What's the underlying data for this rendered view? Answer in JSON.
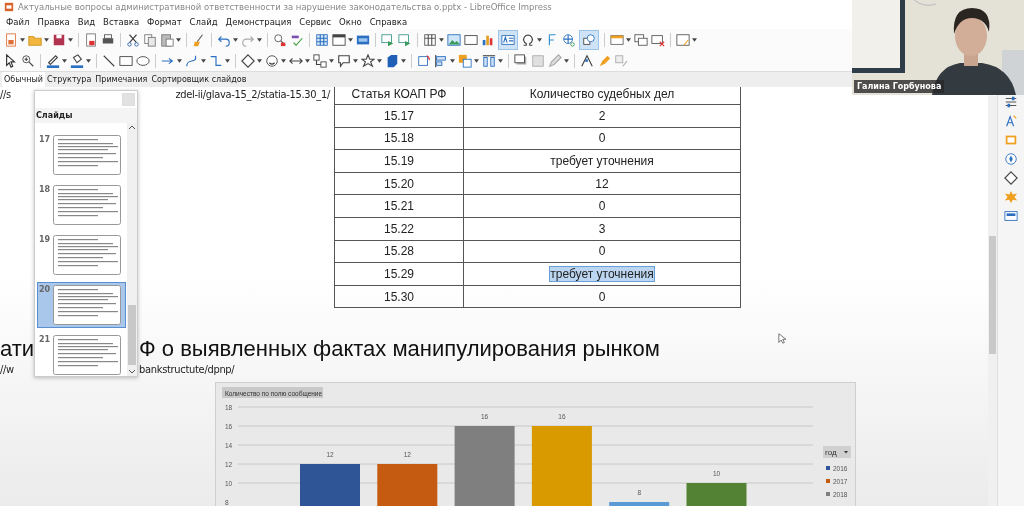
{
  "window": {
    "title": "Актуальные вопросы административной ответственности за нарушение законодательства о.pptx - LibreOffice Impress"
  },
  "menu": [
    "Файл",
    "Правка",
    "Вид",
    "Вставка",
    "Формат",
    "Слайд",
    "Демонстрация",
    "Сервис",
    "Окно",
    "Справка"
  ],
  "toolbar": {
    "insert_text_box": {
      "on": true
    },
    "show_draw_functions": {
      "on": true
    }
  },
  "view_tabs": [
    {
      "label": "Обычный",
      "selected": true
    },
    {
      "label": "Структура",
      "selected": false
    },
    {
      "label": "Примечания",
      "selected": false
    },
    {
      "label": "Сортировщик слайдов",
      "selected": false
    }
  ],
  "slides_panel": {
    "title": "Слайды",
    "slides": [
      {
        "number": "17",
        "selected": false
      },
      {
        "number": "18",
        "selected": false
      },
      {
        "number": "19",
        "selected": false
      },
      {
        "number": "20",
        "selected": true
      },
      {
        "number": "21",
        "selected": false
      }
    ]
  },
  "slide": {
    "link_1": [
      "//s",
      "zdel-ii/glava-15_2/statia-15.30_1/"
    ],
    "table": {
      "columns": [
        "Статья КОАП РФ",
        "Количество судебных дел"
      ],
      "rows": [
        {
          "article": "15.17",
          "count": "2",
          "text_selected": false
        },
        {
          "article": "15.18",
          "count": "0",
          "text_selected": false
        },
        {
          "article": "15.19",
          "count": "требует уточнения",
          "text_selected": false
        },
        {
          "article": "15.20",
          "count": "12",
          "text_selected": false
        },
        {
          "article": "15.21",
          "count": "0",
          "text_selected": false
        },
        {
          "article": "15.22",
          "count": "3",
          "text_selected": false
        },
        {
          "article": "15.28",
          "count": "0",
          "text_selected": false
        },
        {
          "article": "15.29",
          "count": "требует уточнения",
          "text_selected": true
        },
        {
          "article": "15.30",
          "count": "0",
          "text_selected": false
        }
      ]
    },
    "heading": [
      "ати",
      "Ф о выявленных фактах манипулирования рынком"
    ],
    "link_2": [
      "//w",
      "bankstructute/dpnp/"
    ],
    "chart_data": {
      "type": "bar",
      "title": "Количество по полю сообщение",
      "legend_title": "год",
      "legend": true,
      "grid": true,
      "data_labels": true,
      "ylim": [
        8,
        18
      ],
      "yticks": [
        8,
        10,
        12,
        14,
        16,
        18
      ],
      "series": [
        {
          "name": "2016",
          "color": "#2f5597",
          "values": [
            12
          ]
        },
        {
          "name": "2017",
          "color": "#c55a11",
          "values": [
            12
          ]
        },
        {
          "name": "2018",
          "color": "#7f7f7f",
          "values": [
            16
          ]
        },
        {
          "color": "#d99a00",
          "values": [
            16
          ]
        },
        {
          "color": "#5b9bd5",
          "values": [
            8
          ]
        },
        {
          "color": "#548235",
          "values": [
            10
          ]
        }
      ]
    }
  },
  "video": {
    "participant": "Галина Горбунова"
  }
}
